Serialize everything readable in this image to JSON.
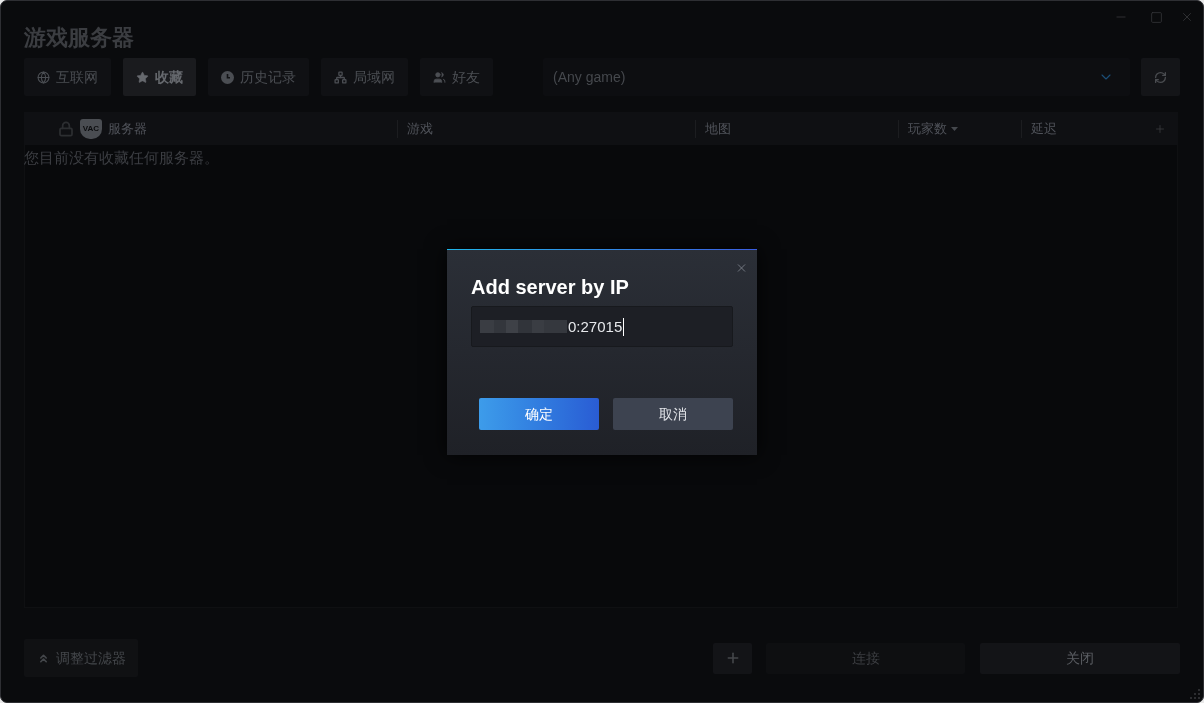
{
  "window": {
    "title": "游戏服务器"
  },
  "tabs": [
    {
      "label": "互联网",
      "selected": false
    },
    {
      "label": "收藏",
      "selected": true
    },
    {
      "label": "历史记录",
      "selected": false
    },
    {
      "label": "局域网",
      "selected": false
    },
    {
      "label": "好友",
      "selected": false
    }
  ],
  "game_filter": {
    "value": "(Any game)"
  },
  "table": {
    "badge": "VAC",
    "columns": [
      {
        "label": "服务器",
        "sorted": false
      },
      {
        "label": "游戏",
        "sorted": false
      },
      {
        "label": "地图",
        "sorted": false
      },
      {
        "label": "玩家数",
        "sorted": true
      },
      {
        "label": "延迟",
        "sorted": false
      }
    ],
    "empty_message": "您目前没有收藏任何服务器。"
  },
  "footer": {
    "filter_button": "调整过滤器",
    "buttons": [
      {
        "label": "连接",
        "disabled": true
      },
      {
        "label": "关闭",
        "disabled": false
      }
    ]
  },
  "dialog": {
    "title": "Add server by IP",
    "input": {
      "value": "0:27015"
    },
    "buttons": [
      {
        "label": "确定",
        "kind": "primary"
      },
      {
        "label": "取消",
        "kind": "secondary"
      }
    ]
  }
}
